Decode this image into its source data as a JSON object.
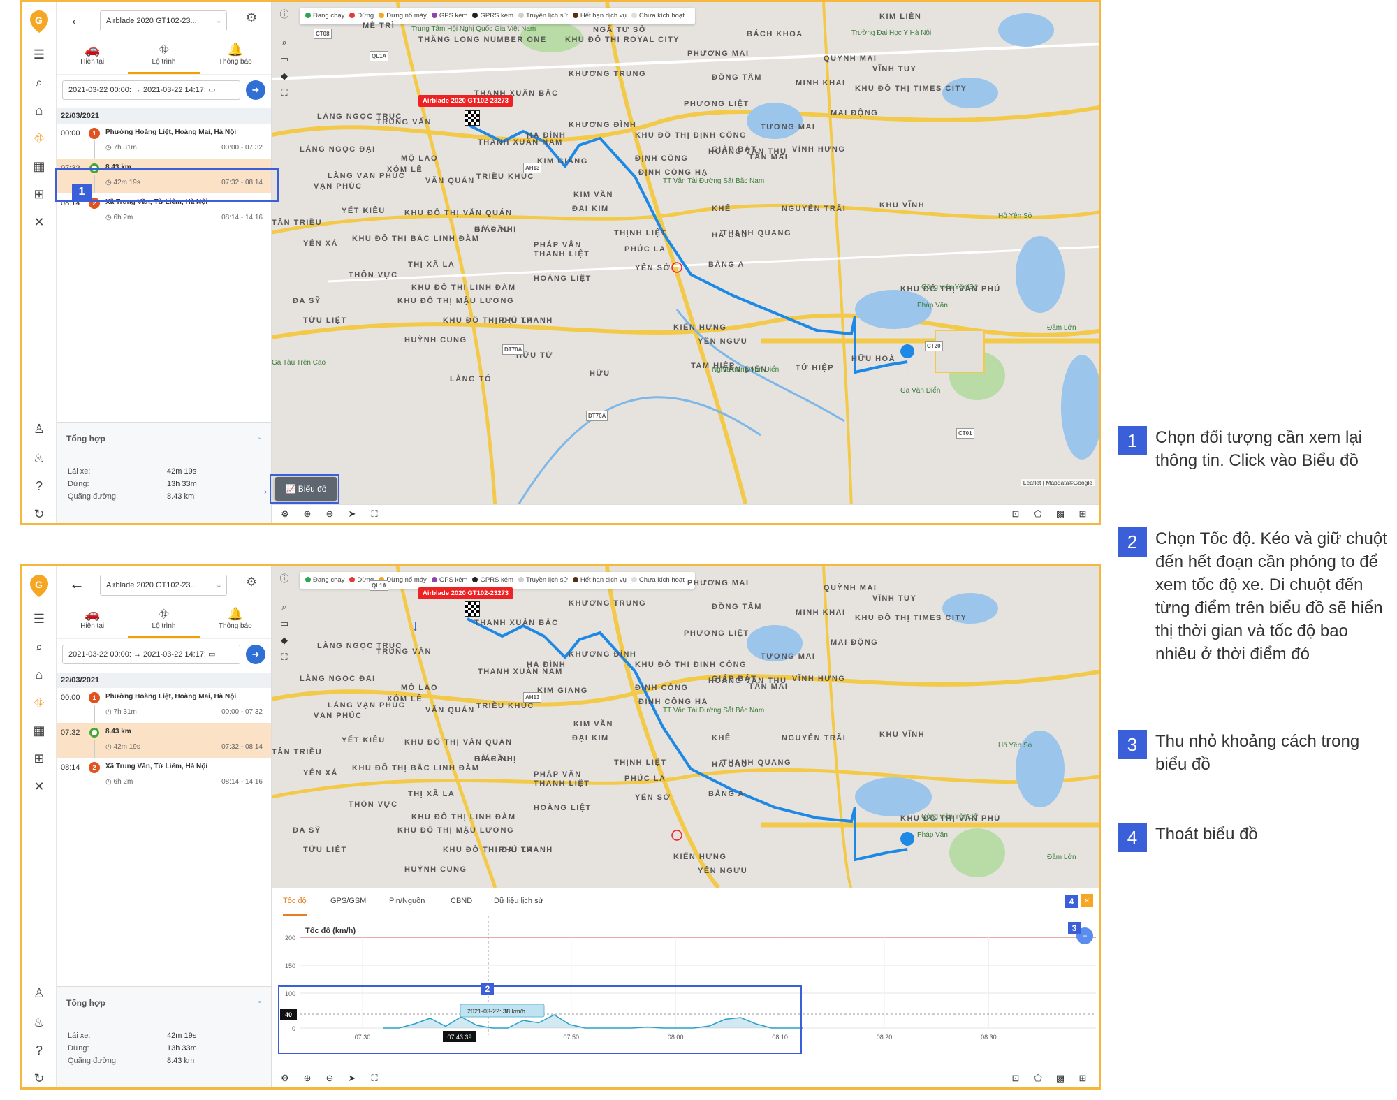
{
  "app": {
    "vehicle_select": "Airblade 2020 GT102-23...",
    "tabs": [
      {
        "label": "Hiện tại",
        "icon": "car-icon"
      },
      {
        "label": "Lộ trình",
        "icon": "route-icon"
      },
      {
        "label": "Thông báo",
        "icon": "bell-icon"
      }
    ],
    "date_from": "2021-03-22 00:00:",
    "date_arrow": "→",
    "date_to": "2021-03-22 14:17:",
    "day": "22/03/2021",
    "trips": [
      {
        "time": "00:00",
        "marker": "1",
        "location": "Phường Hoàng Liệt, Hoàng Mai, Hà Nội",
        "duration": "7h 31m",
        "range": "00:00 - 07:32"
      },
      {
        "time": "07:32",
        "marker": "",
        "location": "8.43 km",
        "duration": "42m 19s",
        "range": "07:32 - 08:14"
      },
      {
        "time": "08:14",
        "marker": "2",
        "location": "Xã Trung Văn, Từ Liêm, Hà Nội",
        "duration": "6h 2m",
        "range": "08:14 - 14:16"
      }
    ],
    "summary": {
      "title": "Tổng hợp",
      "rows": [
        {
          "label": "Lái xe:",
          "value": "42m 19s"
        },
        {
          "label": "Dừng:",
          "value": "13h 33m"
        },
        {
          "label": "Quãng đường:",
          "value": "8.43 km"
        }
      ]
    },
    "legend": [
      {
        "label": "Đang chạy",
        "color": "#2ea44f"
      },
      {
        "label": "Dừng",
        "color": "#e53935"
      },
      {
        "label": "Dừng nổ máy",
        "color": "#f5a623"
      },
      {
        "label": "GPS kém",
        "color": "#8e44ad"
      },
      {
        "label": "GPRS kém",
        "color": "#222222"
      },
      {
        "label": "Truyền lịch sử",
        "color": "#cfcfcf"
      },
      {
        "label": "Hết hạn dịch vụ",
        "color": "#5a2d0c"
      },
      {
        "label": "Chưa kích hoạt",
        "color": "#dddddd"
      }
    ],
    "vehicle_label": "Airblade 2020 GT102-23273",
    "chart_button": "Biểu đồ",
    "attribution": "Leaflet | Mapdata©Google"
  },
  "map_labels": [
    "KIM LIÊN",
    "MÈ TRÌ",
    "THĂNG LONG NUMBER ONE",
    "KHU ĐÔ THỊ ROYAL CITY",
    "NGÃ TƯ SỞ",
    "THANH XUÂN BẮC",
    "KHƯƠNG TRUNG",
    "KHƯƠNG ĐÌNH",
    "PHƯƠNG MAI",
    "ĐỒNG TÂM",
    "BÁCH KHOA",
    "MINH KHAI",
    "QUỲNH MAI",
    "VĨNH TUY",
    "KHU ĐÔ THỊ TIMES CITY",
    "LÀNG NGỌC TRỤC",
    "TRUNG VĂN",
    "PHƯƠNG LIỆT",
    "MAI ĐỘNG",
    "TƯƠNG MAI",
    "LÀNG NGỌC ĐẠI",
    "MỘ LAO",
    "XÓM LÊ",
    "THANH XUÂN NAM",
    "HẠ ĐÌNH",
    "KIM GIANG",
    "KHU ĐÔ THỊ ĐỊNH CÔNG",
    "ĐỊNH CÔNG",
    "HOÀNG VĂN THỤ",
    "VĨNH HƯNG",
    "KHU VĨNH",
    "LÀNG VẠN PHÚC",
    "VẠN PHÚC",
    "VĂN QUÁN",
    "TRIỀU KHÚC",
    "ĐỊNH CÔNG HẠ",
    "GIÁP BÁT",
    "TÂN MAI",
    "KIM VĂN",
    "ĐẠI KIM",
    "YẾT KIÊU",
    "KHU ĐÔ THỊ VĂN QUÁN",
    "GIÁP NHỊ",
    "THỊNH LIỆT",
    "KHÊ",
    "NGUYỄN TRÃI",
    "TÂN TRIỀU",
    "KHU ĐÔ THỊ BẮC LINH ĐÀM",
    "HÀ CẦU",
    "YÊN XÁ",
    "THANH LIỆT",
    "THANH QUANG",
    "PHÁP VÂN",
    "PHÚC LA",
    "HÀ CẦU",
    "THỊ XÃ LA",
    "THÔN VỰC",
    "KHU ĐÔ THỊ LINH ĐÀM",
    "HOÀNG LIỆT",
    "YÊN SỞ",
    "BẰNG A",
    "KHU ĐÔ THỊ VĂN PHÚ",
    "ĐA SỸ",
    "KHU ĐÔ THỊ MẬU LƯƠNG",
    "KHU ĐÔ THỊ ĐẠI THANH",
    "PHÚ LA",
    "TỨU LIỆT",
    "KIẾN HƯNG",
    "HUỲNH CUNG",
    "YÊN NGƯU",
    "HỮU TỪ",
    "TAM HIỆP",
    "VĂN ĐIỂN",
    "TỨ HIỆP",
    "HỮU HOÀ",
    "LÀNG TÓ",
    "HỮU"
  ],
  "map_small_labels": [
    "Trung Tâm Hội Nghị Quốc Gia Việt Nam",
    "Trường Đại Học Y Hà Nội",
    "Công viên Yên Sở",
    "Nghĩa trang Văn Điển",
    "TT Văn Tài Đường Sắt Bắc Nam",
    "Ga Văn Điển",
    "Ga Tàu Trên Cao",
    "Đầm Lớn",
    "Hồ Yên Sở",
    "Pháp Vân"
  ],
  "road_shields": [
    "CT08",
    "QL1A",
    "AH13",
    "DT70A",
    "CT20",
    "CT01",
    "DT70A"
  ],
  "screen2": {
    "chart_tabs": [
      "Tốc độ",
      "GPS/GSM",
      "Pin/Nguồn",
      "CBND",
      "Dữ liệu lịch sử"
    ],
    "close_label": "×",
    "zoom_label": "−",
    "tooltip_date": "2021-03-22:",
    "tooltip_value": "38",
    "tooltip_unit": "km/h",
    "cursor_time": "07:43:39",
    "current_value_badge": "40"
  },
  "chart_data": [
    {
      "type": "line",
      "title": "Tốc độ (km/h)",
      "ylabel": "Tốc độ (km/h)",
      "ylim": [
        0,
        200
      ],
      "yticks": [
        150,
        200
      ],
      "limit_line": 200,
      "grid": true
    },
    {
      "type": "area",
      "ylim": [
        0,
        100
      ],
      "yticks": [
        0,
        100
      ],
      "x": [
        "07:30",
        "07:40",
        "07:50",
        "08:00",
        "08:10",
        "08:20",
        "08:30"
      ],
      "series": [
        {
          "values": [
            0,
            0,
            12,
            28,
            5,
            32,
            8,
            0,
            0,
            22,
            15,
            38,
            10,
            0,
            0,
            0,
            0,
            3,
            0,
            0,
            0,
            6,
            25,
            30,
            12,
            0,
            0,
            0
          ]
        }
      ],
      "grid": true
    }
  ],
  "notes": [
    {
      "num": "1",
      "text": "Chọn đối tượng cần xem lại thông tin. Click vào  Biểu đồ"
    },
    {
      "num": "2",
      "text": "Chọn Tốc độ. Kéo và giữ chuột đến hết đoạn cần phóng to để xem tốc độ xe. Di chuột đến từng điểm trên biểu đồ sẽ hiển thị thời gian và tốc độ bao nhiêu ở thời điểm đó"
    },
    {
      "num": "3",
      "text": "Thu nhỏ khoảng cách trong biểu đồ"
    },
    {
      "num": "4",
      "text": "Thoát biểu đồ"
    }
  ],
  "callouts": [
    "1",
    "2",
    "3",
    "4"
  ],
  "icons": [
    "logo-icon",
    "menu-icon",
    "search-icon",
    "home-icon",
    "route-icon",
    "chart-icon",
    "grid-icon",
    "tools-icon",
    "user-icon",
    "alarm-icon",
    "help-icon",
    "logout-icon"
  ]
}
